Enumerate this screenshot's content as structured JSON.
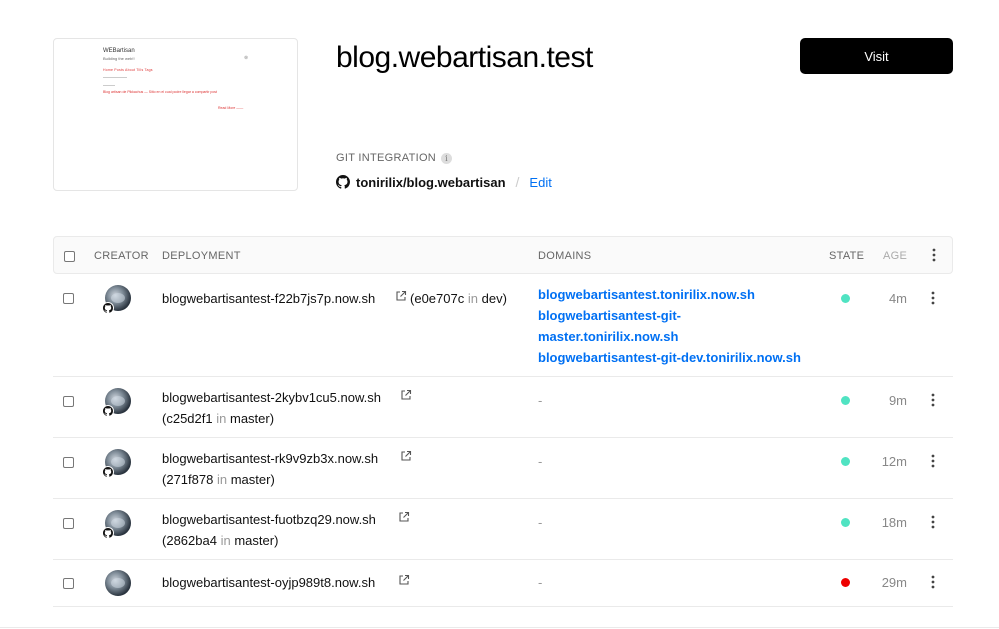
{
  "thumbnail": {
    "title": "WEBartisan",
    "subtitle": "Building the web!!",
    "nav": "Home  Posts  About  Tills  Tags",
    "post": "Blog artisan de Pikkachus — Sitio en el cual podre llegar a compartir post",
    "more": "Read More ——"
  },
  "header": {
    "title": "blog.webartisan.test",
    "visit_label": "Visit"
  },
  "git": {
    "label": "GIT INTEGRATION",
    "info_glyph": "i",
    "repo": "tonirilix/blog.webartisan",
    "separator": "/",
    "edit_label": "Edit"
  },
  "table": {
    "headers": {
      "creator": "CREATOR",
      "deployment": "DEPLOYMENT",
      "domains": "DOMAINS",
      "state": "STATE",
      "age": "AGE"
    },
    "rows": [
      {
        "name": "blogwebartisantest-f22b7js7p.now.sh",
        "sha": "e0e707c",
        "in": "in",
        "branch": "dev",
        "domains": [
          "blogwebartisantest.tonirilix.now.sh",
          "blogwebartisantest-git-",
          "master.tonirilix.now.sh",
          "blogwebartisantest-git-dev.tonirilix.now.sh"
        ],
        "state_color": "#50e3c2",
        "age": "4m"
      },
      {
        "name": "blogwebartisantest-2kybv1cu5.now.sh",
        "sha": "c25d2f1",
        "in": "in",
        "branch": "master",
        "domain_dash": "-",
        "state_color": "#50e3c2",
        "age": "9m"
      },
      {
        "name": "blogwebartisantest-rk9v9zb3x.now.sh",
        "sha": "271f878",
        "in": "in",
        "branch": "master",
        "domain_dash": "-",
        "state_color": "#50e3c2",
        "age": "12m"
      },
      {
        "name": "blogwebartisantest-fuotbzq29.now.sh",
        "sha": "2862ba4",
        "in": "in",
        "branch": "master",
        "domain_dash": "-",
        "state_color": "#50e3c2",
        "age": "18m"
      },
      {
        "name": "blogwebartisantest-oyjp989t8.now.sh",
        "domain_dash": "-",
        "state_color": "#ee0000",
        "age": "29m"
      }
    ]
  }
}
